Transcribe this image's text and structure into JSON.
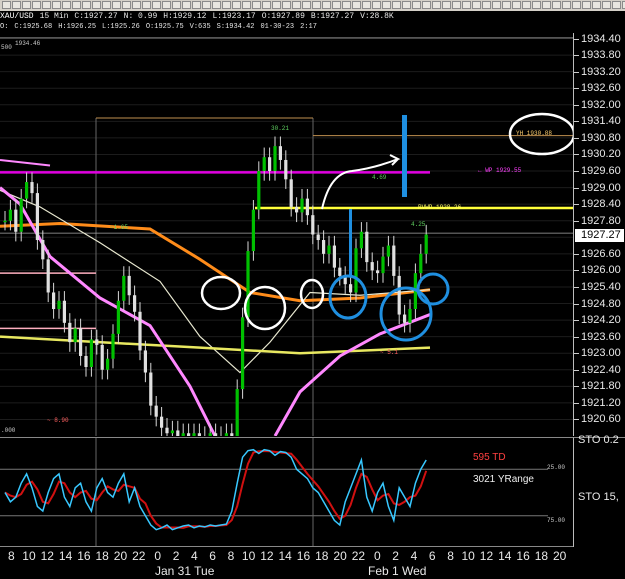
{
  "toolbar": {
    "buttons": [
      "minimize",
      "restore",
      "close",
      "x",
      "x",
      "x",
      "x",
      "x",
      "x",
      "x",
      "x",
      "x",
      "x",
      "x",
      "x",
      "x",
      "x",
      "x",
      "x",
      "x",
      "x",
      "x",
      "x",
      "x",
      "x",
      "x",
      "x",
      "x",
      "x",
      "x",
      "x",
      "x",
      "x",
      "x",
      "x",
      "x",
      "x",
      "x",
      "x",
      "x",
      "x",
      "x",
      "x",
      "x",
      "x",
      "x",
      "x",
      "x",
      "x",
      "x",
      "x",
      "x",
      "x",
      "x",
      "x",
      "x",
      "x",
      "x",
      "x",
      "x",
      "x",
      "x",
      "x",
      "x"
    ]
  },
  "info": {
    "symbol": "XAU/USD",
    "interval": "15 Min",
    "close": "C:1927.27",
    "net": "N:  0.99",
    "high": "H:1929.12",
    "low": "L:1923.17",
    "o": "O:1927.89",
    "b": "B:1927.27",
    "v": "V:28.8K",
    "o2": "O:",
    "c2": "C:1925.68",
    "h2": "H:1926.25",
    "l2": "L:1925.26",
    "o3": "O:1925.75",
    "v2": "V:635",
    "s": "S:1934.42",
    "date": "01-30-23",
    "time": "2:17"
  },
  "price_axis": {
    "labels": [
      "1934.40",
      "1933.80",
      "1933.20",
      "1932.60",
      "1932.00",
      "1931.40",
      "1930.80",
      "1930.20",
      "1929.60",
      "1929.00",
      "1928.40",
      "1927.80",
      "1926.60",
      "1926.00",
      "1925.40",
      "1924.80",
      "1924.20",
      "1923.60",
      "1923.00",
      "1922.40",
      "1921.80",
      "1921.20",
      "1920.60"
    ],
    "current": "1927.27",
    "cut_label": "STO  0.2"
  },
  "top_left": {
    "scale_500": "500",
    "s_value": "1934.46",
    "bottom_000": ".000"
  },
  "annotations": {
    "high_3021": "30.21",
    "minus_890": "~ 8.90",
    "v_1465": "~1.65",
    "yh": "YH 1930.88",
    "wp": "← WP 1929.55",
    "rvwap": "RVWP 1928.26",
    "n_469": "4.69",
    "n_425": "4.25",
    "minus_51": "~ 5.1"
  },
  "stochastic": {
    "td_label": "595 TD",
    "yrange_label": "3021 YRange",
    "sto_label": "STO  15,",
    "level_25": "25.00",
    "level_75": "75.00"
  },
  "time_axis": {
    "hours": [
      "8",
      "10",
      "12",
      "14",
      "16",
      "18",
      "20",
      "22",
      "0",
      "2",
      "4",
      "6",
      "8",
      "10",
      "12",
      "14",
      "16",
      "18",
      "20",
      "22",
      "0",
      "2",
      "4",
      "6",
      "8",
      "10",
      "12",
      "14",
      "16",
      "18",
      "20"
    ],
    "dates": [
      "Jan 31 Tue",
      "Feb 1 Wed"
    ]
  },
  "colors": {
    "magenta": "#e000e0",
    "yellow": "#ffff3a",
    "orange": "#ff8c1a",
    "pink": "#ff88ff",
    "green": "#00c000",
    "blue": "#1f8fe0",
    "stoch_red": "#d01010",
    "stoch_cyan": "#38c8ff"
  },
  "chart_data": {
    "type": "line",
    "title": "",
    "xlabel": "",
    "ylabel": "",
    "ylim": [
      1920.0,
      1934.6
    ],
    "current_price": 1927.27,
    "levels": [
      {
        "label": "YH 1930.88",
        "value": 1930.88
      },
      {
        "label": "WP 1929.55",
        "value": 1929.55
      },
      {
        "label": "RVWP 1928.26",
        "value": 1928.26
      }
    ],
    "close": [
      1927.8,
      1928.2,
      1927.4,
      1928.6,
      1929.2,
      1928.8,
      1927.1,
      1926.4,
      1925.2,
      1924.6,
      1924.9,
      1924.1,
      1923.4,
      1923.9,
      1922.9,
      1922.5,
      1923.5,
      1923.3,
      1922.4,
      1922.8,
      1923.7,
      1924.9,
      1925.8,
      1925.1,
      1924.5,
      1923.1,
      1922.3,
      1921.1,
      1920.7,
      1920.3,
      1920.1,
      1920.2,
      1920.0,
      1920.1,
      1920.0,
      1920.1,
      1920.0,
      1920.0,
      1920.1,
      1920.0,
      1920.0,
      1920.1,
      1920.0,
      1921.7,
      1924.3,
      1926.7,
      1928.2,
      1929.6,
      1930.1,
      1929.6,
      1930.5,
      1930.0,
      1929.3,
      1928.3,
      1928.1,
      1928.6,
      1928.0,
      1927.3,
      1927.1,
      1926.6,
      1926.9,
      1926.1,
      1925.8,
      1925.5,
      1925.2,
      1926.8,
      1927.4,
      1926.3,
      1926.0,
      1925.9,
      1926.5,
      1926.9,
      1925.8,
      1924.4,
      1924.1,
      1924.6,
      1925.9,
      1926.6,
      1927.3
    ],
    "stochastic": [
      50,
      40,
      45,
      60,
      70,
      55,
      35,
      30,
      50,
      65,
      70,
      45,
      35,
      55,
      60,
      40,
      30,
      55,
      65,
      50,
      45,
      60,
      70,
      40,
      55,
      35,
      25,
      15,
      10,
      12,
      15,
      10,
      12,
      14,
      15,
      12,
      14,
      13,
      15,
      14,
      15,
      16,
      30,
      60,
      88,
      95,
      96,
      92,
      96,
      95,
      90,
      94,
      93,
      88,
      75,
      70,
      65,
      55,
      50,
      40,
      30,
      20,
      15,
      40,
      55,
      70,
      85,
      45,
      30,
      50,
      60,
      35,
      20,
      55,
      45,
      35,
      60,
      75,
      85
    ]
  }
}
